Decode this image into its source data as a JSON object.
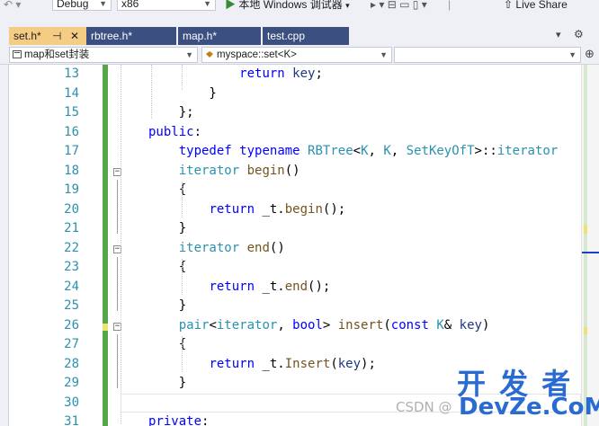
{
  "toolbar": {
    "config": "Debug",
    "platform": "x86",
    "run_label": "本地 Windows 调试器",
    "live_share": "Live Share"
  },
  "tabs": [
    {
      "label": "set.h*",
      "active": true
    },
    {
      "label": "rbtree.h*",
      "active": false
    },
    {
      "label": "map.h*",
      "active": false
    },
    {
      "label": "test.cpp",
      "active": false
    }
  ],
  "nav": {
    "project": "map和set封装",
    "scope": "myspace::set<K>",
    "member": ""
  },
  "editor": {
    "lines": [
      {
        "n": "13",
        "tokens": [
          {
            "t": "            "
          },
          {
            "t": "return",
            "c": "kw"
          },
          {
            "t": " "
          },
          {
            "t": "key",
            "c": "ident"
          },
          {
            "t": ";"
          }
        ]
      },
      {
        "n": "14",
        "tokens": [
          {
            "t": "        }"
          }
        ]
      },
      {
        "n": "15",
        "tokens": [
          {
            "t": "    };"
          }
        ]
      },
      {
        "n": "16",
        "tokens": [
          {
            "t": "public",
            "c": "kw"
          },
          {
            "t": ":"
          }
        ]
      },
      {
        "n": "17",
        "tokens": [
          {
            "t": "    "
          },
          {
            "t": "typedef",
            "c": "kw"
          },
          {
            "t": " "
          },
          {
            "t": "typename",
            "c": "kw"
          },
          {
            "t": " "
          },
          {
            "t": "RBTree",
            "c": "ty"
          },
          {
            "t": "<"
          },
          {
            "t": "K",
            "c": "ty"
          },
          {
            "t": ", "
          },
          {
            "t": "K",
            "c": "ty"
          },
          {
            "t": ", "
          },
          {
            "t": "SetKeyOfT",
            "c": "ty"
          },
          {
            "t": ">::"
          },
          {
            "t": "iterator",
            "c": "ty"
          }
        ]
      },
      {
        "n": "18",
        "tokens": [
          {
            "t": "    "
          },
          {
            "t": "iterator",
            "c": "ty"
          },
          {
            "t": " "
          },
          {
            "t": "begin",
            "c": "fn"
          },
          {
            "t": "()"
          }
        ]
      },
      {
        "n": "19",
        "tokens": [
          {
            "t": "    {"
          }
        ]
      },
      {
        "n": "20",
        "tokens": [
          {
            "t": "        "
          },
          {
            "t": "return",
            "c": "kw"
          },
          {
            "t": " _t."
          },
          {
            "t": "begin",
            "c": "fn"
          },
          {
            "t": "();"
          }
        ]
      },
      {
        "n": "21",
        "tokens": [
          {
            "t": "    }"
          }
        ]
      },
      {
        "n": "22",
        "tokens": [
          {
            "t": "    "
          },
          {
            "t": "iterator",
            "c": "ty"
          },
          {
            "t": " "
          },
          {
            "t": "end",
            "c": "fn"
          },
          {
            "t": "()"
          }
        ]
      },
      {
        "n": "23",
        "tokens": [
          {
            "t": "    {"
          }
        ]
      },
      {
        "n": "24",
        "tokens": [
          {
            "t": "        "
          },
          {
            "t": "return",
            "c": "kw"
          },
          {
            "t": " _t."
          },
          {
            "t": "end",
            "c": "fn"
          },
          {
            "t": "();"
          }
        ]
      },
      {
        "n": "25",
        "tokens": [
          {
            "t": "    }"
          }
        ]
      },
      {
        "n": "26",
        "tokens": [
          {
            "t": "    "
          },
          {
            "t": "pair",
            "c": "ty"
          },
          {
            "t": "<"
          },
          {
            "t": "iterator",
            "c": "ty"
          },
          {
            "t": ", "
          },
          {
            "t": "bool",
            "c": "kw"
          },
          {
            "t": "> "
          },
          {
            "t": "insert",
            "c": "fn"
          },
          {
            "t": "("
          },
          {
            "t": "const",
            "c": "kw"
          },
          {
            "t": " "
          },
          {
            "t": "K",
            "c": "ty"
          },
          {
            "t": "& "
          },
          {
            "t": "key",
            "c": "ident"
          },
          {
            "t": ")"
          }
        ]
      },
      {
        "n": "27",
        "tokens": [
          {
            "t": "    {"
          }
        ]
      },
      {
        "n": "28",
        "tokens": [
          {
            "t": "        "
          },
          {
            "t": "return",
            "c": "kw"
          },
          {
            "t": " _t."
          },
          {
            "t": "Insert",
            "c": "fn"
          },
          {
            "t": "("
          },
          {
            "t": "key",
            "c": "ident"
          },
          {
            "t": ");"
          }
        ]
      },
      {
        "n": "29",
        "tokens": [
          {
            "t": "    }"
          }
        ]
      },
      {
        "n": "30",
        "tokens": [
          {
            "t": ""
          }
        ]
      },
      {
        "n": "31",
        "tokens": [
          {
            "t": "private",
            "c": "kw"
          },
          {
            "t": ":"
          }
        ]
      }
    ]
  },
  "watermark": {
    "csdn": "CSDN @",
    "kaifazhe": "开 发 者",
    "devze": "DevZe.CoM"
  },
  "colors": {
    "tab_bg": "#3b4f81",
    "tab_active": "#f5cc84",
    "change_green": "#57a64a",
    "change_yellow": "#efe36f"
  }
}
